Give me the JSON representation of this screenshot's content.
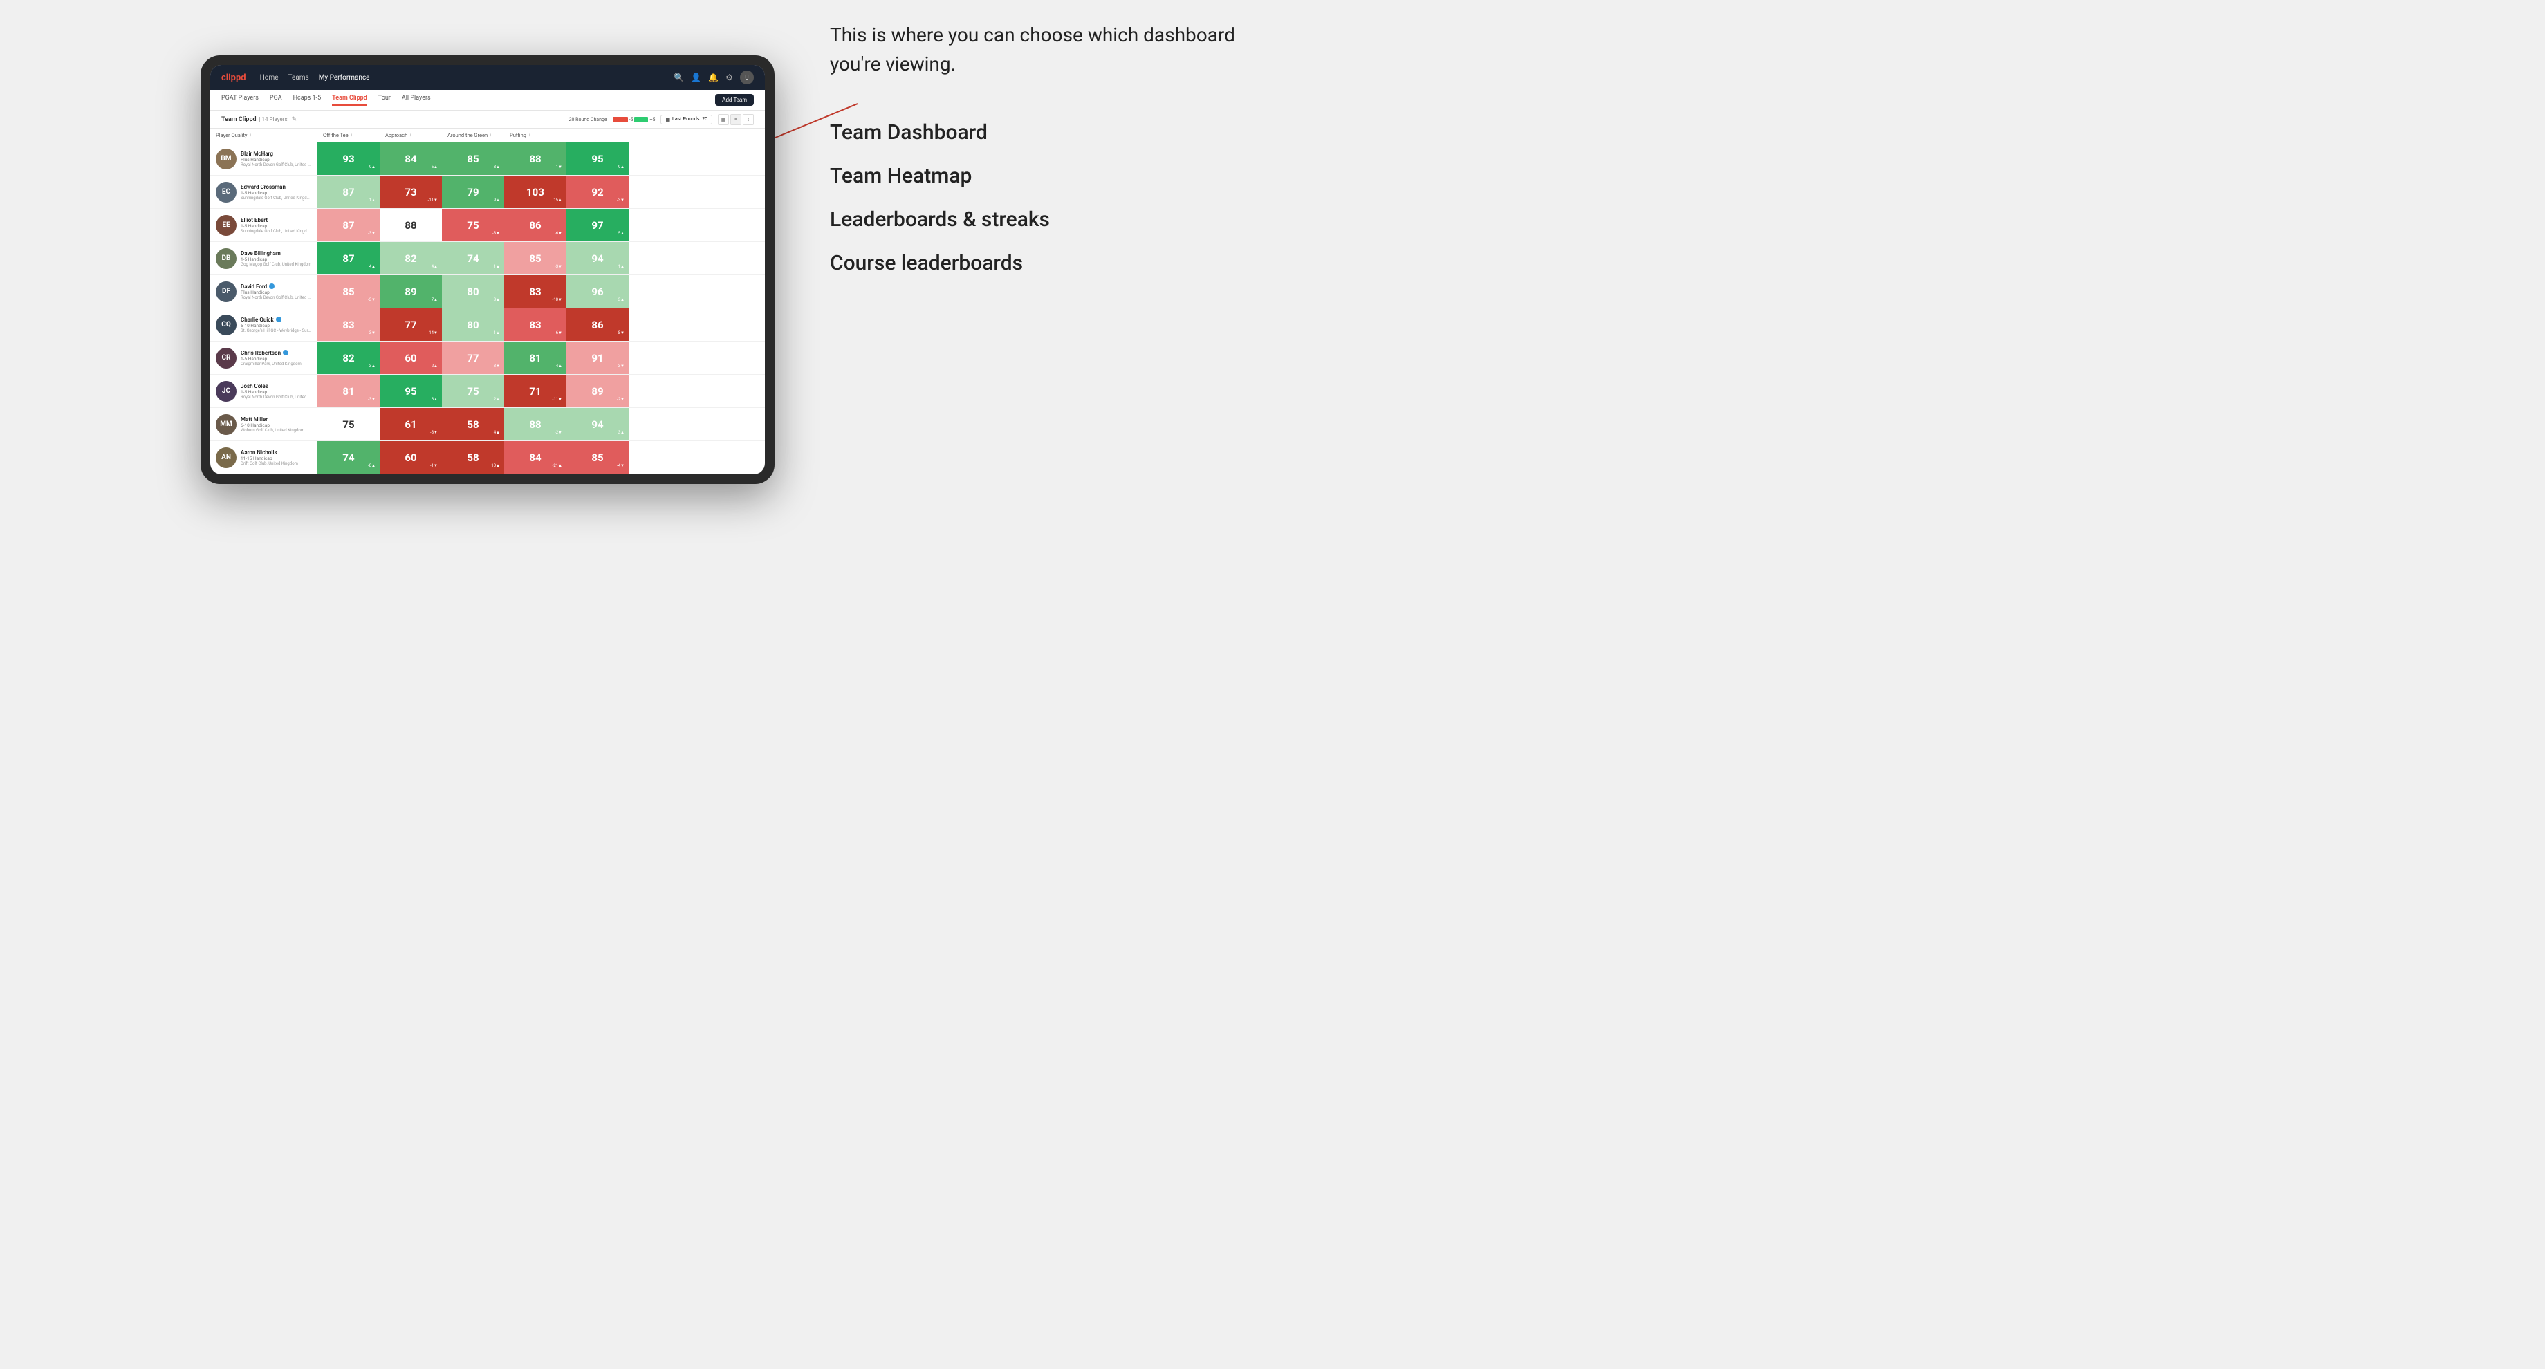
{
  "annotation": {
    "intro_text": "This is where you can choose which dashboard you're viewing.",
    "menu_items": [
      "Team Dashboard",
      "Team Heatmap",
      "Leaderboards & streaks",
      "Course leaderboards"
    ]
  },
  "nav": {
    "logo": "clippd",
    "links": [
      "Home",
      "Teams",
      "My Performance"
    ],
    "active_link": "My Performance"
  },
  "sub_nav": {
    "links": [
      "PGAT Players",
      "PGA",
      "Hcaps 1-5",
      "Team Clippd",
      "Tour",
      "All Players"
    ],
    "active": "Team Clippd",
    "add_team_label": "Add Team"
  },
  "team_header": {
    "title": "Team Clippd",
    "separator": "|",
    "count": "14 Players",
    "round_change_label": "20 Round Change",
    "bar_neg": "-5",
    "bar_pos": "+5",
    "last_rounds_label": "Last Rounds:",
    "last_rounds_value": "20"
  },
  "columns": [
    {
      "label": "Player Quality",
      "arrow": "↓",
      "id": "quality"
    },
    {
      "label": "Off the Tee",
      "arrow": "↓",
      "id": "tee"
    },
    {
      "label": "Approach",
      "arrow": "↓",
      "id": "approach"
    },
    {
      "label": "Around the Green",
      "arrow": "↓",
      "id": "green"
    },
    {
      "label": "Putting",
      "arrow": "↓",
      "id": "putting"
    }
  ],
  "players": [
    {
      "name": "Blair McHarg",
      "handicap": "Plus Handicap",
      "club": "Royal North Devon Golf Club, United Kingdom",
      "avatar_color": "#8B7355",
      "initials": "BM",
      "scores": [
        {
          "value": "93",
          "delta": "9▲",
          "color": "green-dark"
        },
        {
          "value": "84",
          "delta": "6▲",
          "color": "green-light"
        },
        {
          "value": "85",
          "delta": "8▲",
          "color": "green-light"
        },
        {
          "value": "88",
          "delta": "-1▼",
          "color": "green-light"
        },
        {
          "value": "95",
          "delta": "9▲",
          "color": "green-dark"
        }
      ]
    },
    {
      "name": "Edward Crossman",
      "handicap": "1-5 Handicap",
      "club": "Sunningdale Golf Club, United Kingdom",
      "avatar_color": "#5a6a7a",
      "initials": "EC",
      "scores": [
        {
          "value": "87",
          "delta": "1▲",
          "color": "green-pale"
        },
        {
          "value": "73",
          "delta": "-11▼",
          "color": "red-dark"
        },
        {
          "value": "79",
          "delta": "9▲",
          "color": "green-light"
        },
        {
          "value": "103",
          "delta": "15▲",
          "color": "red-dark"
        },
        {
          "value": "92",
          "delta": "-3▼",
          "color": "red-light"
        }
      ]
    },
    {
      "name": "Elliot Ebert",
      "handicap": "1-5 Handicap",
      "club": "Sunningdale Golf Club, United Kingdom",
      "avatar_color": "#7a4a3a",
      "initials": "EE",
      "scores": [
        {
          "value": "87",
          "delta": "-3▼",
          "color": "red-pale"
        },
        {
          "value": "88",
          "delta": "",
          "color": "white-bg"
        },
        {
          "value": "75",
          "delta": "-3▼",
          "color": "red-light"
        },
        {
          "value": "86",
          "delta": "-6▼",
          "color": "red-light"
        },
        {
          "value": "97",
          "delta": "5▲",
          "color": "green-dark"
        }
      ]
    },
    {
      "name": "Dave Billingham",
      "handicap": "1-5 Handicap",
      "club": "Gog Magog Golf Club, United Kingdom",
      "avatar_color": "#6a7a5a",
      "initials": "DB",
      "scores": [
        {
          "value": "87",
          "delta": "4▲",
          "color": "green-dark"
        },
        {
          "value": "82",
          "delta": "4▲",
          "color": "green-pale"
        },
        {
          "value": "74",
          "delta": "1▲",
          "color": "green-pale"
        },
        {
          "value": "85",
          "delta": "-3▼",
          "color": "red-pale"
        },
        {
          "value": "94",
          "delta": "1▲",
          "color": "green-pale"
        }
      ]
    },
    {
      "name": "David Ford",
      "handicap": "Plus Handicap",
      "club": "Royal North Devon Golf Club, United Kingdom",
      "avatar_color": "#4a5a6a",
      "initials": "DF",
      "badge": true,
      "scores": [
        {
          "value": "85",
          "delta": "-3▼",
          "color": "red-pale"
        },
        {
          "value": "89",
          "delta": "7▲",
          "color": "green-light"
        },
        {
          "value": "80",
          "delta": "3▲",
          "color": "green-pale"
        },
        {
          "value": "83",
          "delta": "-10▼",
          "color": "red-dark"
        },
        {
          "value": "96",
          "delta": "3▲",
          "color": "green-pale"
        }
      ]
    },
    {
      "name": "Charlie Quick",
      "handicap": "6-10 Handicap",
      "club": "St. George's Hill GC - Weybridge - Surrey, Uni...",
      "avatar_color": "#3a4a5a",
      "initials": "CQ",
      "badge": true,
      "scores": [
        {
          "value": "83",
          "delta": "-3▼",
          "color": "red-pale"
        },
        {
          "value": "77",
          "delta": "-14▼",
          "color": "red-dark"
        },
        {
          "value": "80",
          "delta": "1▲",
          "color": "green-pale"
        },
        {
          "value": "83",
          "delta": "-6▼",
          "color": "red-light"
        },
        {
          "value": "86",
          "delta": "-8▼",
          "color": "red-dark"
        }
      ]
    },
    {
      "name": "Chris Robertson",
      "handicap": "1-5 Handicap",
      "club": "Craigmillar Park, United Kingdom",
      "avatar_color": "#5a3a4a",
      "initials": "CR",
      "badge": true,
      "scores": [
        {
          "value": "82",
          "delta": "-3▲",
          "color": "green-dark"
        },
        {
          "value": "60",
          "delta": "2▲",
          "color": "red-light"
        },
        {
          "value": "77",
          "delta": "-3▼",
          "color": "red-pale"
        },
        {
          "value": "81",
          "delta": "4▲",
          "color": "green-light"
        },
        {
          "value": "91",
          "delta": "-3▼",
          "color": "red-pale"
        }
      ]
    },
    {
      "name": "Josh Coles",
      "handicap": "1-5 Handicap",
      "club": "Royal North Devon Golf Club, United Kingdom",
      "avatar_color": "#4a3a5a",
      "initials": "JC",
      "scores": [
        {
          "value": "81",
          "delta": "-3▼",
          "color": "red-pale"
        },
        {
          "value": "95",
          "delta": "8▲",
          "color": "green-dark"
        },
        {
          "value": "75",
          "delta": "2▲",
          "color": "green-pale"
        },
        {
          "value": "71",
          "delta": "-11▼",
          "color": "red-dark"
        },
        {
          "value": "89",
          "delta": "-2▼",
          "color": "red-pale"
        }
      ]
    },
    {
      "name": "Matt Miller",
      "handicap": "6-10 Handicap",
      "club": "Woburn Golf Club, United Kingdom",
      "avatar_color": "#6a5a4a",
      "initials": "MM",
      "scores": [
        {
          "value": "75",
          "delta": "",
          "color": "white-bg"
        },
        {
          "value": "61",
          "delta": "-3▼",
          "color": "red-dark"
        },
        {
          "value": "58",
          "delta": "4▲",
          "color": "red-dark"
        },
        {
          "value": "88",
          "delta": "-2▼",
          "color": "green-pale"
        },
        {
          "value": "94",
          "delta": "3▲",
          "color": "green-pale"
        }
      ]
    },
    {
      "name": "Aaron Nicholls",
      "handicap": "11-15 Handicap",
      "club": "Drift Golf Club, United Kingdom",
      "avatar_color": "#7a6a4a",
      "initials": "AN",
      "scores": [
        {
          "value": "74",
          "delta": "-8▲",
          "color": "green-light"
        },
        {
          "value": "60",
          "delta": "-1▼",
          "color": "red-dark"
        },
        {
          "value": "58",
          "delta": "10▲",
          "color": "red-dark"
        },
        {
          "value": "84",
          "delta": "-21▲",
          "color": "red-light"
        },
        {
          "value": "85",
          "delta": "-4▼",
          "color": "red-light"
        }
      ]
    }
  ]
}
